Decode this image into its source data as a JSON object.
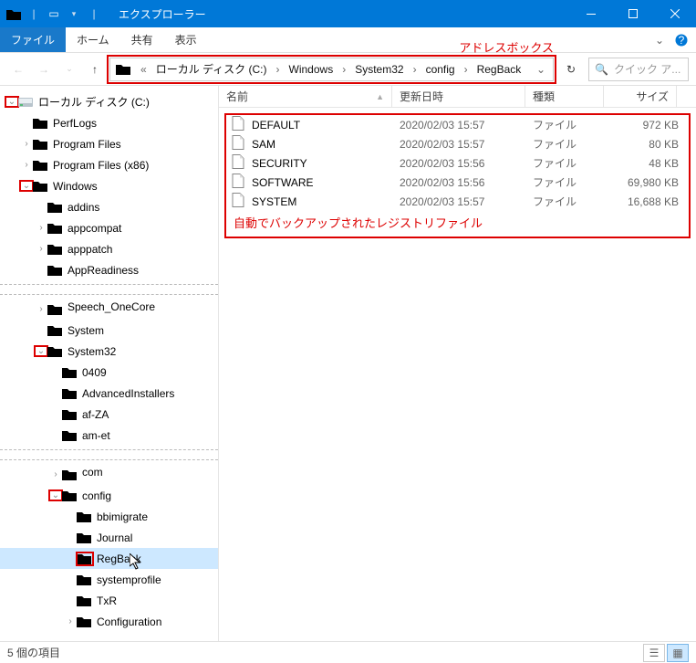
{
  "window": {
    "title": "エクスプローラー"
  },
  "ribbon": {
    "file": "ファイル",
    "home": "ホーム",
    "share": "共有",
    "view": "表示"
  },
  "annotations": {
    "address": "アドレスボックス",
    "files": "自動でバックアップされたレジストリファイル"
  },
  "address": {
    "prefix": "«",
    "segments": [
      "ローカル ディスク (C:)",
      "Windows",
      "System32",
      "config",
      "RegBack"
    ]
  },
  "search": {
    "placeholder": "クイック ア..."
  },
  "columns": {
    "name": "名前",
    "date": "更新日時",
    "type": "種類",
    "size": "サイズ"
  },
  "files": [
    {
      "name": "DEFAULT",
      "date": "2020/02/03 15:57",
      "type": "ファイル",
      "size": "972 KB"
    },
    {
      "name": "SAM",
      "date": "2020/02/03 15:57",
      "type": "ファイル",
      "size": "80 KB"
    },
    {
      "name": "SECURITY",
      "date": "2020/02/03 15:56",
      "type": "ファイル",
      "size": "48 KB"
    },
    {
      "name": "SOFTWARE",
      "date": "2020/02/03 15:56",
      "type": "ファイル",
      "size": "69,980 KB"
    },
    {
      "name": "SYSTEM",
      "date": "2020/02/03 15:57",
      "type": "ファイル",
      "size": "16,688 KB"
    }
  ],
  "tree": {
    "section1": [
      {
        "indent": 0,
        "exp": "v",
        "icon": "disk",
        "label": "ローカル ディスク (C:)",
        "redExp": true
      },
      {
        "indent": 1,
        "exp": "",
        "icon": "folder",
        "label": "PerfLogs"
      },
      {
        "indent": 1,
        "exp": ">",
        "icon": "folder",
        "label": "Program Files"
      },
      {
        "indent": 1,
        "exp": ">",
        "icon": "folder",
        "label": "Program Files (x86)"
      },
      {
        "indent": 1,
        "exp": "v",
        "icon": "folder",
        "label": "Windows",
        "redExp": true
      },
      {
        "indent": 2,
        "exp": "",
        "icon": "folder",
        "label": "addins"
      },
      {
        "indent": 2,
        "exp": ">",
        "icon": "folder",
        "label": "appcompat"
      },
      {
        "indent": 2,
        "exp": ">",
        "icon": "folder",
        "label": "apppatch"
      },
      {
        "indent": 2,
        "exp": "",
        "icon": "folder",
        "label": "AppReadiness"
      }
    ],
    "section2": [
      {
        "indent": 2,
        "exp": ">",
        "icon": "folder",
        "label": "Speech_OneCore",
        "cut": true
      },
      {
        "indent": 2,
        "exp": "",
        "icon": "folder",
        "label": "System"
      },
      {
        "indent": 2,
        "exp": "v",
        "icon": "folder",
        "label": "System32",
        "redExp": true
      },
      {
        "indent": 3,
        "exp": "",
        "icon": "folder",
        "label": "0409"
      },
      {
        "indent": 3,
        "exp": "",
        "icon": "folder",
        "label": "AdvancedInstallers"
      },
      {
        "indent": 3,
        "exp": "",
        "icon": "folder",
        "label": "af-ZA"
      },
      {
        "indent": 3,
        "exp": "",
        "icon": "folder",
        "label": "am-et"
      }
    ],
    "section3": [
      {
        "indent": 3,
        "exp": ">",
        "icon": "folder",
        "label": "com",
        "cut": true
      },
      {
        "indent": 3,
        "exp": "v",
        "icon": "folder",
        "label": "config",
        "redExp": true
      },
      {
        "indent": 4,
        "exp": "",
        "icon": "folder",
        "label": "bbimigrate"
      },
      {
        "indent": 4,
        "exp": "",
        "icon": "folder",
        "label": "Journal"
      },
      {
        "indent": 4,
        "exp": "",
        "icon": "folder",
        "label": "RegBack",
        "selected": true,
        "redbox": true,
        "cursor": true
      },
      {
        "indent": 4,
        "exp": "",
        "icon": "folder",
        "label": "systemprofile"
      },
      {
        "indent": 4,
        "exp": "",
        "icon": "folder",
        "label": "TxR"
      },
      {
        "indent": 4,
        "exp": ">",
        "icon": "folder",
        "label": "Configuration"
      }
    ]
  },
  "status": {
    "text": "5 個の項目"
  }
}
